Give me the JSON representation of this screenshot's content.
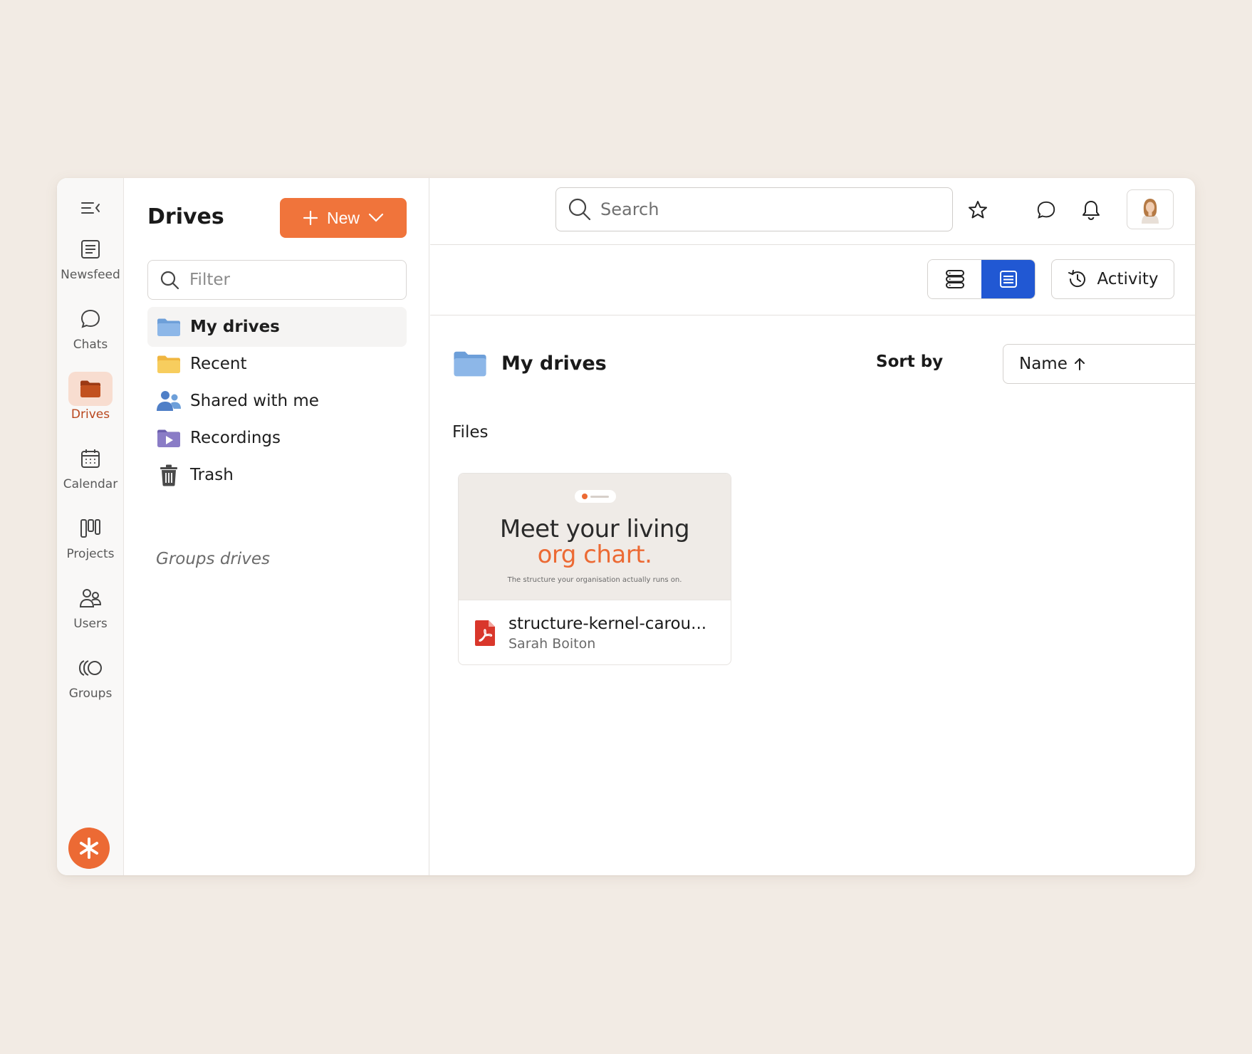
{
  "rail": {
    "items": [
      {
        "label": "Newsfeed",
        "icon": "newsfeed-icon"
      },
      {
        "label": "Chats",
        "icon": "chat-bubble-icon"
      },
      {
        "label": "Drives",
        "icon": "folder-icon",
        "active": true
      },
      {
        "label": "Calendar",
        "icon": "calendar-icon"
      },
      {
        "label": "Projects",
        "icon": "projects-icon"
      },
      {
        "label": "Users",
        "icon": "users-icon"
      },
      {
        "label": "Groups",
        "icon": "groups-icon"
      }
    ]
  },
  "panel": {
    "title": "Drives",
    "new_label": "New",
    "filter_placeholder": "Filter",
    "nav": [
      {
        "label": "My drives",
        "icon": "blue-folder-icon",
        "active": true
      },
      {
        "label": "Recent",
        "icon": "yellow-folder-icon"
      },
      {
        "label": "Shared with me",
        "icon": "shared-users-icon"
      },
      {
        "label": "Recordings",
        "icon": "recordings-folder-icon"
      },
      {
        "label": "Trash",
        "icon": "trash-icon"
      }
    ],
    "groups_label": "Groups drives"
  },
  "topbar": {
    "search_placeholder": "Search"
  },
  "toolbar": {
    "activity_label": "Activity"
  },
  "content": {
    "title": "My drives",
    "sort_label": "Sort by",
    "sort_value": "Name",
    "files_label": "Files",
    "files": [
      {
        "name": "structure-kernel-carou...",
        "owner": "Sarah Boiton",
        "thumb_line1": "Meet your living",
        "thumb_line2": "org chart.",
        "thumb_sub": "The structure your organisation actually runs on."
      }
    ]
  },
  "colors": {
    "accent": "#f0743b",
    "active_view": "#2158d3",
    "rail_active_bg": "#f8ddd0",
    "rail_active_text": "#b8461c",
    "background": "#f2ebe4"
  }
}
